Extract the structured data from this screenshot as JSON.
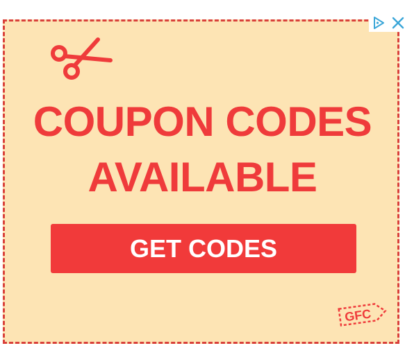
{
  "ad": {
    "headline_line1": "COUPON CODES",
    "headline_line2": "AVAILABLE",
    "cta_label": "GET CODES",
    "badge_text": "GFC",
    "icons": {
      "scissors": "scissors-icon",
      "adchoices": "adchoices-icon",
      "close": "close-icon"
    },
    "colors": {
      "accent": "#ef3b3b",
      "background": "#fde4b4",
      "border": "#d9403a",
      "button": "#f13a3a",
      "button_text": "#ffffff",
      "adchoices": "#3aa6d8"
    }
  }
}
